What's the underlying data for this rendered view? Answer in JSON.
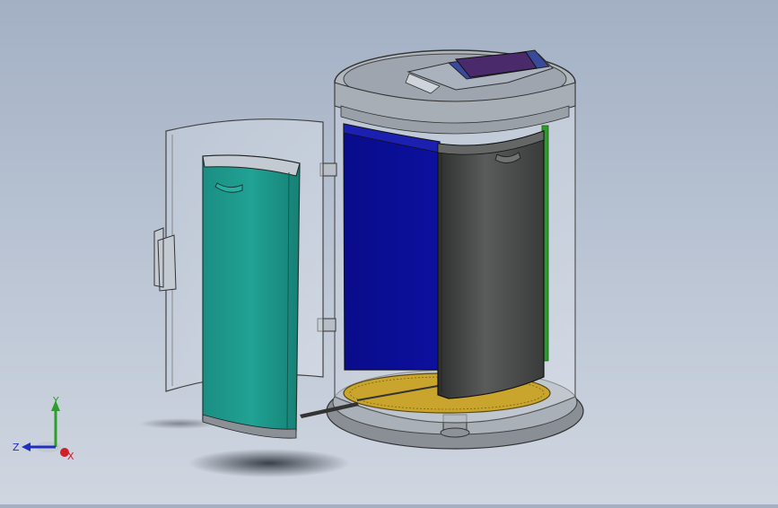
{
  "viewport": {
    "background_top": "#a3b0c4",
    "background_bottom": "#cfd6e0"
  },
  "model": {
    "colors": {
      "teal_bin": "#1e9a8c",
      "blue_bin": "#0b0e9a",
      "dark_bin": "#4a4b4b",
      "gold_base": "#c9a52e",
      "green_strip": "#2e9a2e",
      "control_panel": "#4a2a6a"
    }
  },
  "triad": {
    "x_label": "X",
    "y_label": "Y",
    "z_label": "Z",
    "x_color": "#d0202a",
    "y_color": "#2aa02a",
    "z_color": "#2030c0"
  }
}
